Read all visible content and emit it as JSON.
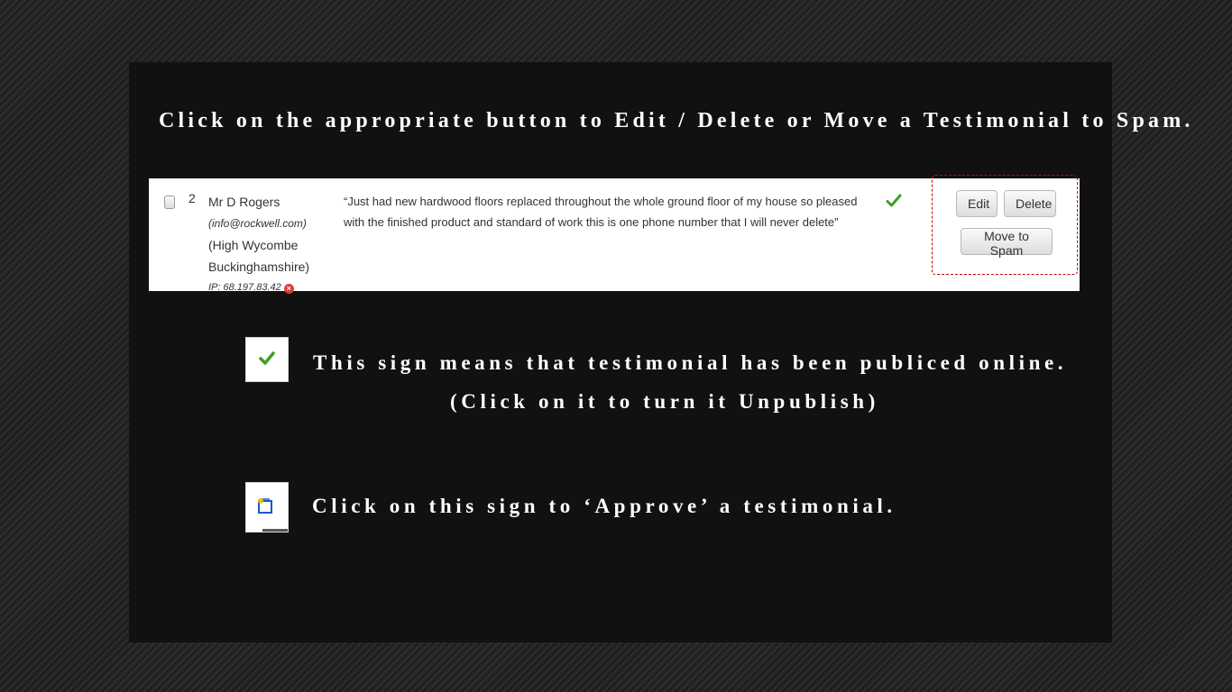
{
  "heading": "Click on the appropriate button to Edit / Delete or Move a Testimonial to Spam.",
  "example_row": {
    "number": "2",
    "author_name": "Mr D Rogers",
    "author_email": "(info@rockwell.com)",
    "author_location_line1": "(High Wycombe",
    "author_location_line2": "Buckinghamshire)",
    "ip_label": "IP: 68.197.83.42",
    "quote": "“Just had new hardwood floors replaced throughout the whole ground floor of my house so pleased with the finished product and standard of work this is one phone number that I will never delete”",
    "published_icon": "green-checkmark-icon",
    "edit_label": "Edit",
    "delete_label": "Delete",
    "spam_label": "Move to Spam"
  },
  "published_info": {
    "icon": "green-checkmark-icon",
    "text_line1": "This sign means that testimonial has been publiced online.",
    "text_line2": "(Click on it to turn it Unpublish)"
  },
  "approve_info": {
    "icon": "approve-icon",
    "text": "Click on this sign to ‘Approve’ a testimonial."
  },
  "colors": {
    "page_background": "#262626",
    "panel_background": "#111111",
    "highlight_border": "#cc0000",
    "check_green": "#3ea01f"
  }
}
